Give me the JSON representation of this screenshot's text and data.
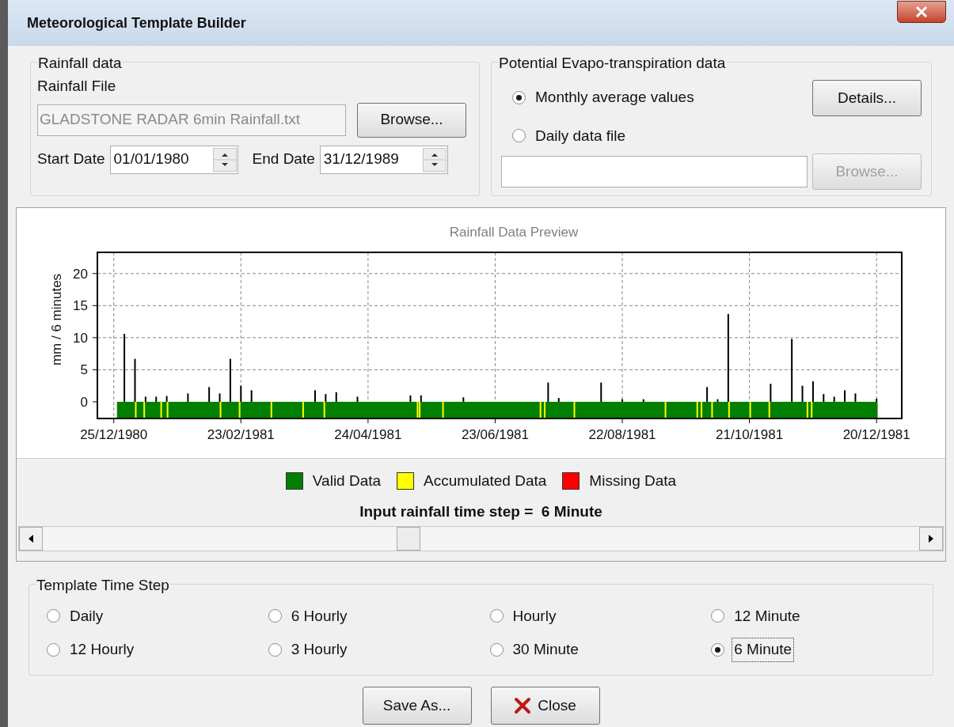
{
  "window": {
    "title": "Meteorological Template Builder"
  },
  "rainfall_data": {
    "legend": "Rainfall data",
    "file_label": "Rainfall File",
    "file_value": "GLADSTONE RADAR 6min Rainfall.txt",
    "file_disabled": true,
    "browse_button": "Browse...",
    "start_date_label": "Start Date",
    "start_date": "01/01/1980",
    "end_date_label": "End Date",
    "end_date": "31/12/1989"
  },
  "pet_data": {
    "legend": "Potential Evapo-transpiration data",
    "options": [
      {
        "label": "Monthly average values",
        "selected": true
      },
      {
        "label": "Daily data file",
        "selected": false
      }
    ],
    "details_button": "Details...",
    "browse_button": {
      "label": "Browse...",
      "disabled": true
    }
  },
  "preview": {
    "chart_data": {
      "type": "bar",
      "title": "Rainfall Data Preview",
      "ylabel": "mm / 6 minutes",
      "grid": true,
      "ylim": [
        -2.6,
        23.3
      ],
      "categories": [
        "25/12/1980",
        null,
        null,
        null,
        null,
        null,
        null,
        null,
        null,
        null,
        null,
        null,
        "23/02/1981",
        null,
        null,
        null,
        null,
        null,
        null,
        null,
        null,
        null,
        null,
        null,
        "24/04/1981",
        null,
        null,
        null,
        null,
        null,
        null,
        null,
        null,
        null,
        null,
        null,
        "23/06/1981",
        null,
        null,
        null,
        null,
        null,
        null,
        null,
        null,
        null,
        null,
        null,
        "22/08/1981",
        null,
        null,
        null,
        null,
        null,
        null,
        null,
        null,
        null,
        null,
        null,
        "21/10/1981",
        null,
        null,
        null,
        null,
        null,
        null,
        null,
        null,
        null,
        null,
        null,
        "20/12/1981"
      ],
      "yticks": [
        0,
        5,
        10,
        15,
        20
      ],
      "values": [
        null,
        10.6,
        6.7,
        0.8,
        0.8,
        0.9,
        null,
        1.3,
        null,
        2.3,
        1.3,
        6.7,
        2.5,
        1.8,
        null,
        null,
        null,
        null,
        null,
        1.8,
        1.2,
        1.5,
        null,
        0.8,
        null,
        null,
        null,
        null,
        1.0,
        1.0,
        null,
        null,
        null,
        0.7,
        null,
        null,
        null,
        null,
        null,
        null,
        null,
        3.0,
        0.6,
        null,
        null,
        null,
        3.0,
        null,
        0.4,
        null,
        0.4,
        null,
        null,
        null,
        null,
        null,
        2.3,
        0.4,
        13.7,
        null,
        null,
        null,
        2.8,
        null,
        9.8,
        2.5,
        3.2,
        1.2,
        0.8,
        1.8,
        1.3,
        null,
        0.5
      ]
    },
    "legend": [
      {
        "label": "Valid Data",
        "color": "#007f00"
      },
      {
        "label": "Accumulated Data",
        "color": "#ffff00"
      },
      {
        "label": "Missing Data",
        "color": "#ff0000"
      }
    ],
    "time_step_note": "Input rainfall time step =  6 Minute"
  },
  "template_time_step": {
    "legend": "Template Time Step",
    "options": [
      {
        "label": "Daily",
        "selected": false
      },
      {
        "label": "6 Hourly",
        "selected": false
      },
      {
        "label": "Hourly",
        "selected": false
      },
      {
        "label": "12 Minute",
        "selected": false
      },
      {
        "label": "12 Hourly",
        "selected": false
      },
      {
        "label": "3 Hourly",
        "selected": false
      },
      {
        "label": "30 Minute",
        "selected": false
      },
      {
        "label": "6 Minute",
        "selected": true
      }
    ]
  },
  "buttons": [
    {
      "label": "Save As...",
      "kind": "plain"
    },
    {
      "label": "Close",
      "kind": "close"
    }
  ]
}
